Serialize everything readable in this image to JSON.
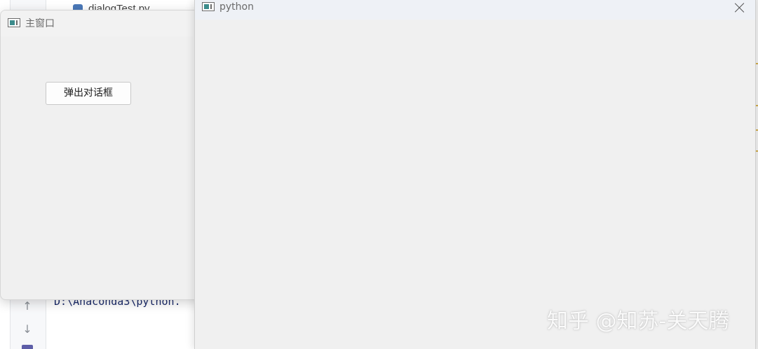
{
  "ide": {
    "file_tab": "dialogTest.py",
    "console_line": "D:\\Anaconda3\\python."
  },
  "main_window": {
    "title": "主窗口",
    "popup_button": "弹出对话框"
  },
  "dialog": {
    "title": "python"
  },
  "watermark": "知乎 @知苏-关天腾"
}
